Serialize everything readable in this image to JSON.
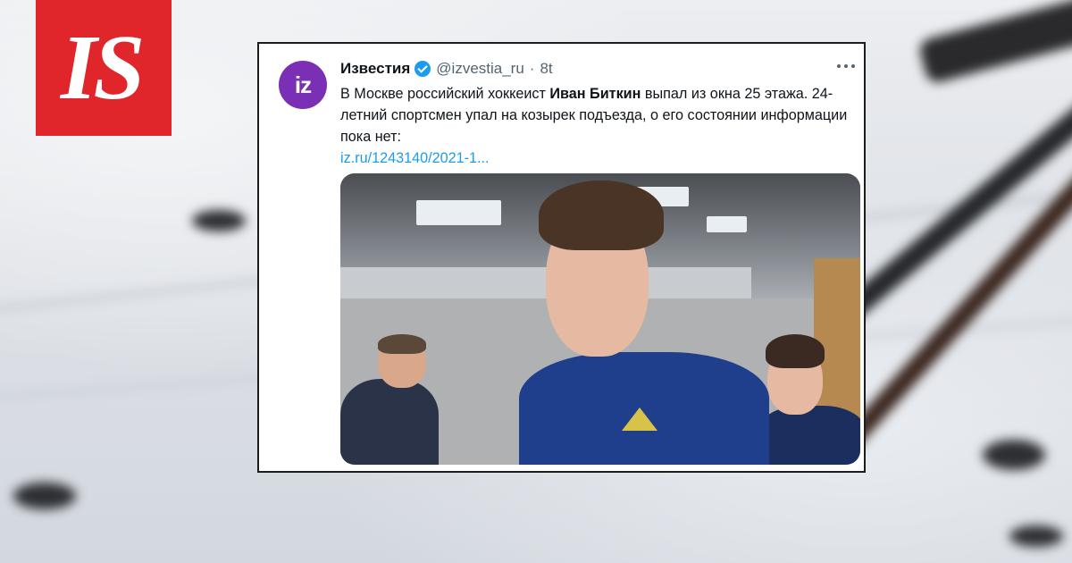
{
  "logo": {
    "text": "IS"
  },
  "tweet": {
    "avatar_text": "iz",
    "display_name": "Известия",
    "handle": "@izvestia_ru",
    "separator": "·",
    "time": "8t",
    "text_before": "В Москве российский хоккеист ",
    "text_bold": "Иван Биткин",
    "text_after": " выпал из окна 25 этажа. 24-летний спортсмен упал на козырек подъезда, о его состоянии информации пока нет:",
    "link": "iz.ru/1243140/2021-1..."
  },
  "colors": {
    "logo_red": "#e0262b",
    "avatar_purple": "#7a2fb5",
    "verified_blue": "#1d9bf0",
    "link_blue": "#1d9bf0",
    "text": "#0f1419",
    "muted": "#536471"
  },
  "icons": [
    "verified-badge-icon",
    "more-options-icon"
  ]
}
